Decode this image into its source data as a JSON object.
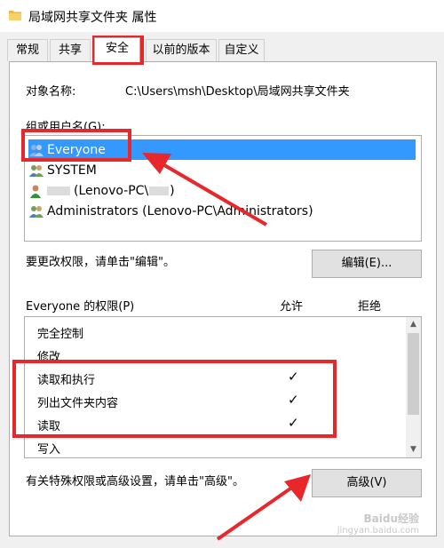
{
  "window": {
    "title": "局域网共享文件夹 属性",
    "icon": "folder-icon"
  },
  "tabs": [
    {
      "label": "常规",
      "active": false
    },
    {
      "label": "共享",
      "active": false
    },
    {
      "label": "安全",
      "active": true
    },
    {
      "label": "以前的版本",
      "active": false
    },
    {
      "label": "自定义",
      "active": false
    }
  ],
  "security": {
    "object_name_label": "对象名称:",
    "object_name_value": "C:\\Users\\msh\\Desktop\\局域网共享文件夹",
    "groups_label": "组或用户名(G):",
    "users": [
      {
        "name": "Everyone",
        "icon": "users-group-icon",
        "selected": true
      },
      {
        "name": "SYSTEM",
        "icon": "users-group-icon",
        "selected": false
      },
      {
        "name": "(Lenovo-PC\\",
        "suffix": ")",
        "icon": "user-icon",
        "selected": false
      },
      {
        "name": "Administrators (Lenovo-PC\\Administrators)",
        "icon": "users-group-icon",
        "selected": false
      }
    ],
    "edit_hint": "要更改权限，请单击\"编辑\"。",
    "edit_button": "编辑(E)...",
    "permissions_label": "Everyone 的权限(P)",
    "allow_header": "允许",
    "deny_header": "拒绝",
    "permissions": [
      {
        "name": "完全控制",
        "allow": "",
        "deny": ""
      },
      {
        "name": "修改",
        "allow": "",
        "deny": ""
      },
      {
        "name": "读取和执行",
        "allow": "✓",
        "deny": ""
      },
      {
        "name": "列出文件夹内容",
        "allow": "✓",
        "deny": ""
      },
      {
        "name": "读取",
        "allow": "✓",
        "deny": ""
      },
      {
        "name": "写入",
        "allow": "",
        "deny": ""
      }
    ],
    "advanced_hint": "有关特殊权限或高级设置，请单击\"高级\"。",
    "advanced_button": "高级(V)"
  },
  "watermark": {
    "line1": "Baidu经验",
    "line2": "jingyan.baidu.com"
  },
  "colors": {
    "highlight": "#e8272b",
    "selection": "#3399ff"
  }
}
